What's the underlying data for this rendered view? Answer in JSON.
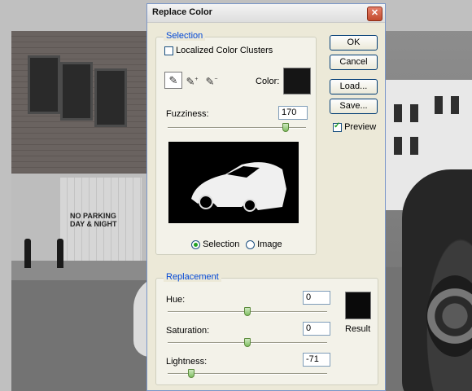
{
  "dialog": {
    "title": "Replace Color",
    "close_glyph": "✕"
  },
  "selection": {
    "legend": "Selection",
    "localized_label": "Localized Color Clusters",
    "localized_checked": false,
    "eyedroppers": [
      "eyedropper-icon",
      "eyedropper-plus-icon",
      "eyedropper-minus-icon"
    ],
    "color_label": "Color:",
    "color_swatch": "#151515",
    "fuzziness_label": "Fuzziness:",
    "fuzziness_value": "170",
    "fuzziness_level": 0.85,
    "radio_selection": "Selection",
    "radio_image": "Image",
    "selected_mode": "Selection"
  },
  "buttons": {
    "ok": "OK",
    "cancel": "Cancel",
    "load": "Load...",
    "save": "Save...",
    "preview_label": "Preview",
    "preview_checked": true
  },
  "replacement": {
    "legend": "Replacement",
    "hue_label": "Hue:",
    "hue_value": "0",
    "hue_level": 0.5,
    "saturation_label": "Saturation:",
    "saturation_value": "0",
    "saturation_level": 0.5,
    "lightness_label": "Lightness:",
    "lightness_value": "-71",
    "lightness_level": 0.15,
    "result_label": "Result",
    "result_swatch": "#0a0a0a"
  },
  "background": {
    "sign_line1": "NO PARKING",
    "sign_line2": "DAY & NIGHT"
  }
}
